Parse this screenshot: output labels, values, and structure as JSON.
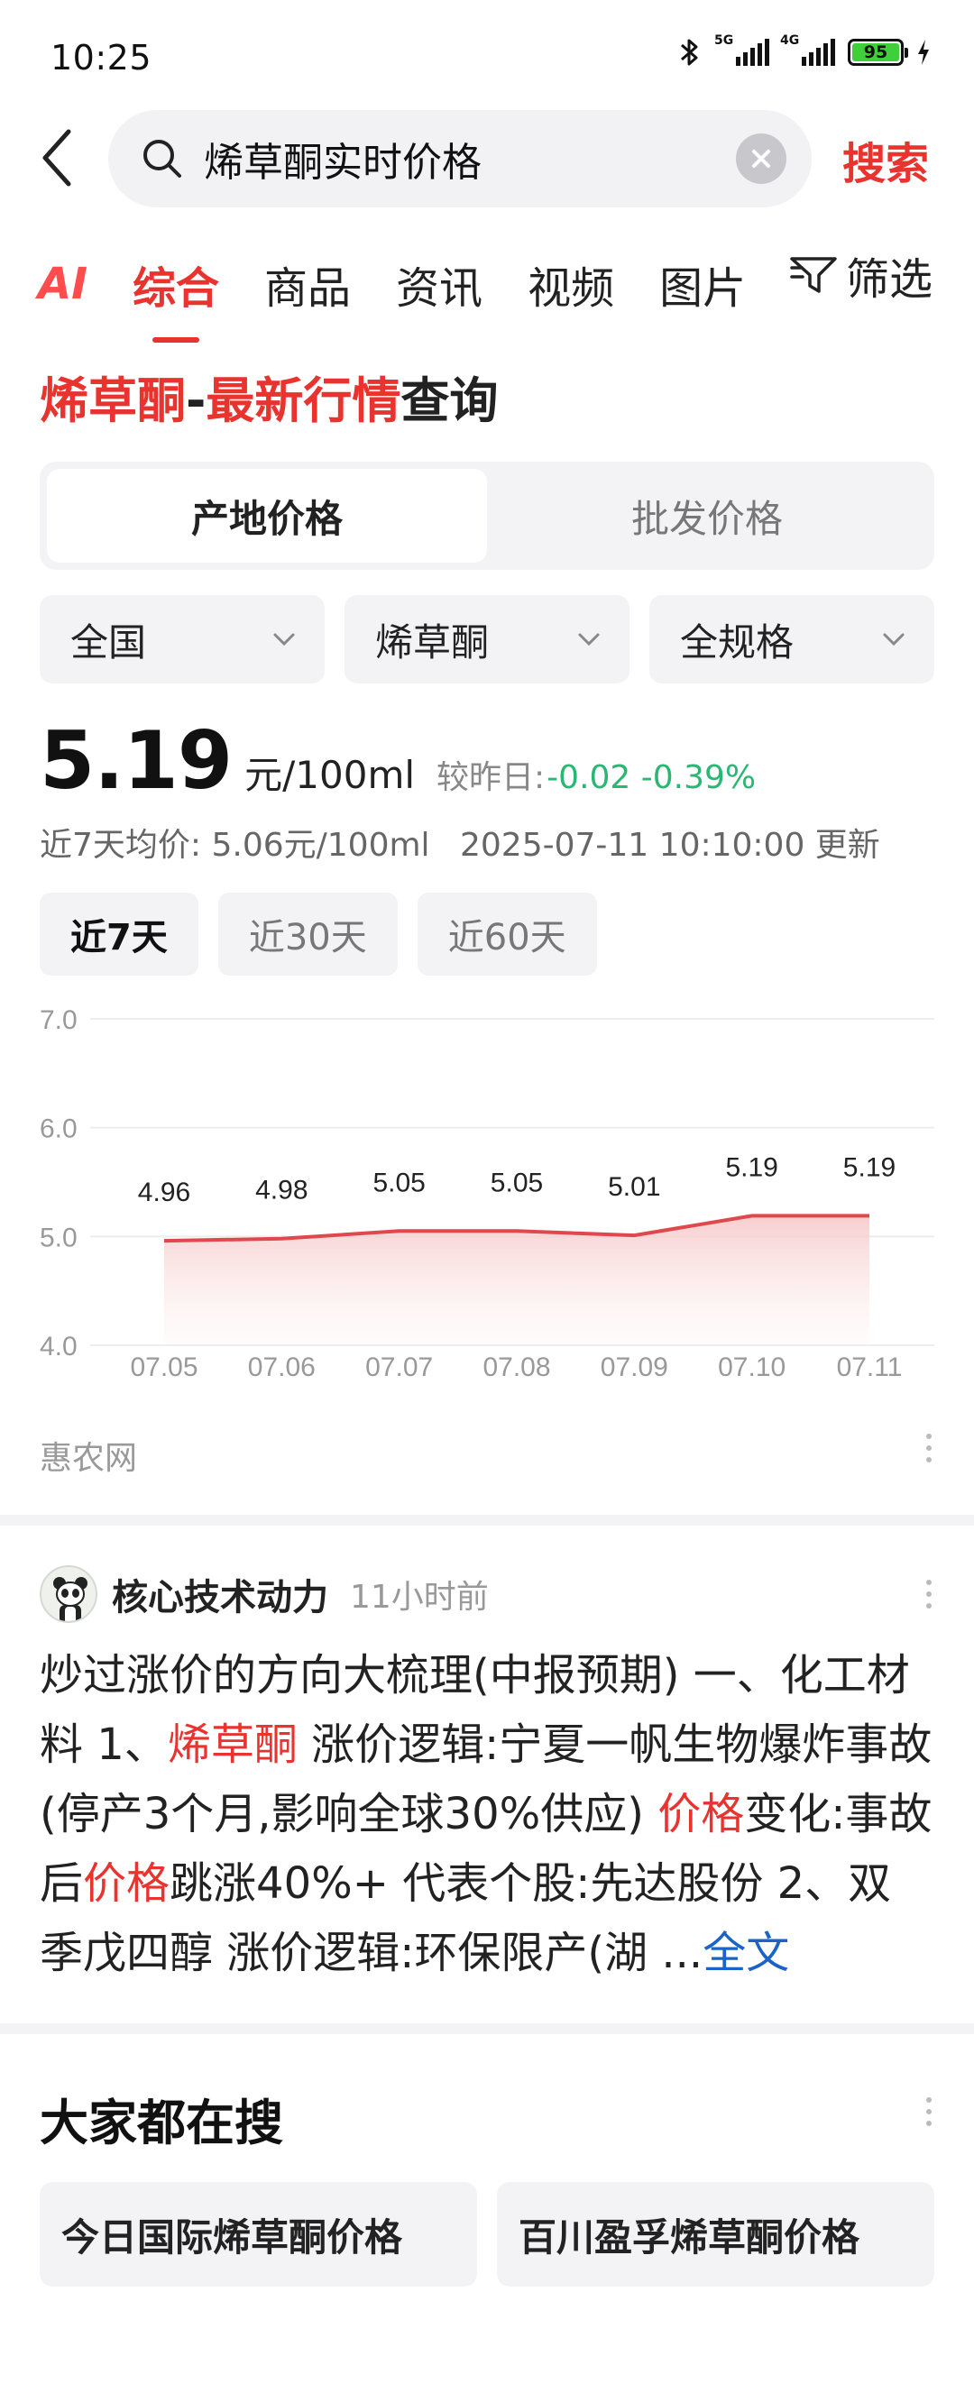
{
  "status_bar": {
    "time": "10:25",
    "network_1": "5G",
    "network_2": "4G",
    "battery": "95",
    "icons": [
      "bluetooth-icon",
      "signal-icon",
      "battery-icon",
      "charging-icon"
    ]
  },
  "search": {
    "query": "烯草酮实时价格",
    "button_label": "搜索"
  },
  "tabs": [
    {
      "label": "AI"
    },
    {
      "label": "综合"
    },
    {
      "label": "商品"
    },
    {
      "label": "资讯"
    },
    {
      "label": "视频"
    },
    {
      "label": "图片"
    }
  ],
  "filter_label": "筛选",
  "headline": {
    "part1": "烯草酮",
    "sep": "-",
    "part2": "最新行情",
    "part3": "查询"
  },
  "segment": {
    "left": "产地价格",
    "right": "批发价格"
  },
  "dropdowns": [
    {
      "value": "全国"
    },
    {
      "value": "烯草酮"
    },
    {
      "value": "全规格"
    }
  ],
  "price": {
    "value": "5.19",
    "unit": "元/100ml",
    "compare_label": "较昨日:",
    "change": "-0.02 -0.39%",
    "avg_text": "近7天均价: 5.06元/100ml",
    "updated": "2025-07-11 10:10:00 更新"
  },
  "ranges": [
    {
      "label": "近7天"
    },
    {
      "label": "近30天"
    },
    {
      "label": "近60天"
    }
  ],
  "chart_data": {
    "type": "area",
    "categories": [
      "07.05",
      "07.06",
      "07.07",
      "07.08",
      "07.09",
      "07.10",
      "07.11"
    ],
    "values": [
      4.96,
      4.98,
      5.05,
      5.05,
      5.01,
      5.19,
      5.19
    ],
    "data_labels": [
      "4.96",
      "4.98",
      "5.05",
      "5.05",
      "5.01",
      "5.19",
      "5.19"
    ],
    "y_ticks": [
      "7.0",
      "6.0",
      "5.0",
      "4.0"
    ],
    "ylim": [
      4.0,
      7.0
    ],
    "grid": true,
    "line_color": "#e0484d"
  },
  "source": "惠农网",
  "post": {
    "author": "核心技术动力",
    "time": "11小时前",
    "seg1": "炒过涨价的方向大梳理(中报预期) 一、化工材料 1、",
    "hl1": "烯草酮",
    "seg2": " 涨价逻辑:宁夏一帆生物爆炸事故(停产3个月,影响全球30%供应) ",
    "hl2": "价格",
    "seg3": "变化:事故后",
    "hl3": "价格",
    "seg4": "跳涨40%+ 代表个股:先达股份 2、双季戊四醇 涨价逻辑:环保限产(湖 ...",
    "full_label": "全文"
  },
  "hot": {
    "title": "大家都在搜",
    "items": [
      "今日国际烯草酮价格",
      "百川盈孚烯草酮价格"
    ]
  },
  "colors": {
    "accent": "#e8332f",
    "down": "#2bb673",
    "link": "#1a63c7"
  }
}
